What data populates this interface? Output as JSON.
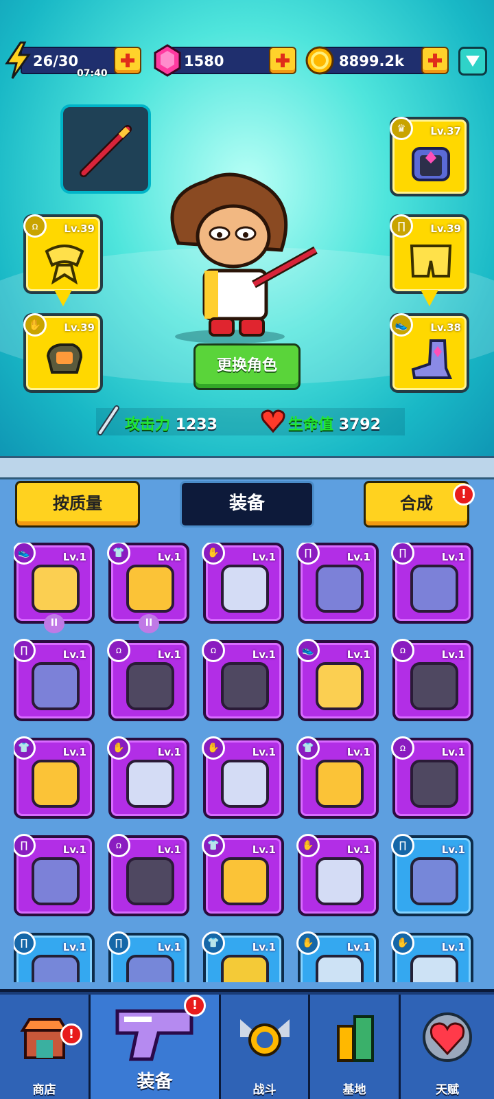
{
  "resources": {
    "energy": {
      "value": "26/30",
      "timer": "07:40",
      "icon": "lightning-icon"
    },
    "gems": {
      "value": "1580",
      "icon": "gem-icon"
    },
    "coins": {
      "value": "8899.2k",
      "icon": "coin-icon"
    }
  },
  "equipped": [
    {
      "name": "helmet",
      "level": "Lv.37"
    },
    {
      "name": "amulet",
      "level": "Lv.39"
    },
    {
      "name": "pants",
      "level": "Lv.39"
    },
    {
      "name": "glove",
      "level": "Lv.39"
    },
    {
      "name": "shoes",
      "level": "Lv.38"
    }
  ],
  "character": {
    "change_label": "更换角色"
  },
  "stats": {
    "attack_label": "攻击力",
    "attack_value": "1233",
    "hp_label": "生命值",
    "hp_value": "3792"
  },
  "tabs": {
    "sort_label": "按质量",
    "title": "装备",
    "merge_label": "合成",
    "merge_alert": "!"
  },
  "inventory": [
    {
      "level": "Lv.1",
      "type": "shoes",
      "rarity": "purple"
    },
    {
      "level": "Lv.1",
      "type": "shirt",
      "rarity": "purple"
    },
    {
      "level": "Lv.1",
      "type": "glove",
      "rarity": "purple"
    },
    {
      "level": "Lv.1",
      "type": "pants",
      "rarity": "purple"
    },
    {
      "level": "Lv.1",
      "type": "pants",
      "rarity": "purple"
    },
    {
      "level": "Lv.1",
      "type": "pants",
      "rarity": "purple"
    },
    {
      "level": "Lv.1",
      "type": "amulet",
      "rarity": "purple"
    },
    {
      "level": "Lv.1",
      "type": "amulet",
      "rarity": "purple"
    },
    {
      "level": "Lv.1",
      "type": "shoes",
      "rarity": "purple"
    },
    {
      "level": "Lv.1",
      "type": "amulet",
      "rarity": "purple"
    },
    {
      "level": "Lv.1",
      "type": "shirt",
      "rarity": "purple"
    },
    {
      "level": "Lv.1",
      "type": "glove",
      "rarity": "purple"
    },
    {
      "level": "Lv.1",
      "type": "glove",
      "rarity": "purple"
    },
    {
      "level": "Lv.1",
      "type": "shirt",
      "rarity": "purple"
    },
    {
      "level": "Lv.1",
      "type": "amulet",
      "rarity": "purple"
    },
    {
      "level": "Lv.1",
      "type": "pants",
      "rarity": "purple"
    },
    {
      "level": "Lv.1",
      "type": "amulet",
      "rarity": "purple"
    },
    {
      "level": "Lv.1",
      "type": "shirt",
      "rarity": "purple"
    },
    {
      "level": "Lv.1",
      "type": "glove",
      "rarity": "purple"
    },
    {
      "level": "Lv.1",
      "type": "pants",
      "rarity": "blue"
    },
    {
      "level": "Lv.1",
      "type": "pants",
      "rarity": "blue"
    },
    {
      "level": "Lv.1",
      "type": "pants",
      "rarity": "blue"
    },
    {
      "level": "Lv.1",
      "type": "shirt",
      "rarity": "blue"
    },
    {
      "level": "Lv.1",
      "type": "glove",
      "rarity": "blue"
    },
    {
      "level": "Lv.1",
      "type": "glove",
      "rarity": "blue"
    }
  ],
  "nav": [
    {
      "label": "商店",
      "icon": "shop-icon",
      "alert": "!"
    },
    {
      "label": "装备",
      "icon": "gun-icon",
      "alert": "!"
    },
    {
      "label": "战斗",
      "icon": "battle-icon"
    },
    {
      "label": "基地",
      "icon": "base-icon"
    },
    {
      "label": "天赋",
      "icon": "talent-icon"
    }
  ],
  "colors": {
    "purple_rarity": "#b22ee6",
    "blue_rarity": "#34a8f0",
    "gold_slot": "#ffd800",
    "accent_green": "#5ad43a"
  }
}
